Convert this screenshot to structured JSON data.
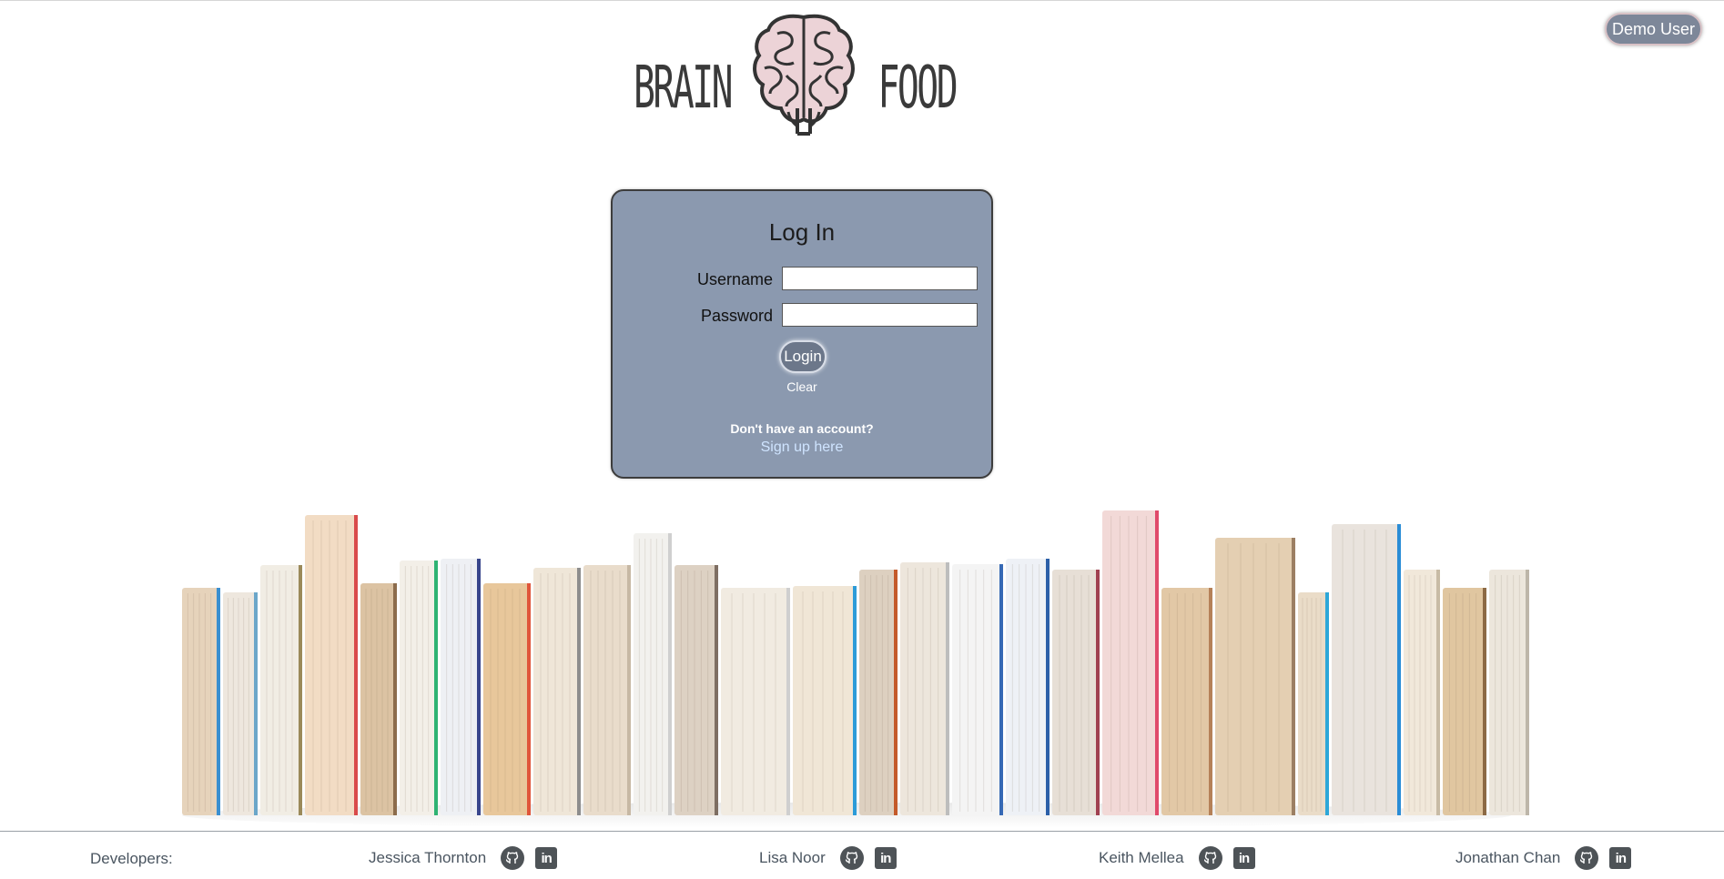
{
  "header": {
    "demo_button_label": "Demo User",
    "logo_left": "BRAIN",
    "logo_right": "FOOD"
  },
  "login": {
    "title": "Log In",
    "username_label": "Username",
    "username_value": "",
    "password_label": "Password",
    "password_value": "",
    "login_button": "Login",
    "clear_link": "Clear",
    "no_account_text": "Don't have an account?",
    "signup_link": "Sign up here"
  },
  "colors": {
    "card_background": "#8b99af",
    "button_background": "#6c778a",
    "signup_link": "#cfe4ff"
  },
  "footer": {
    "label": "Developers:",
    "developers": [
      {
        "name": "Jessica Thornton",
        "github_icon": "github-icon",
        "linkedin_icon": "linkedin-icon"
      },
      {
        "name": "Lisa Noor",
        "github_icon": "github-icon",
        "linkedin_icon": "linkedin-icon"
      },
      {
        "name": "Keith Mellea",
        "github_icon": "github-icon",
        "linkedin_icon": "linkedin-icon"
      },
      {
        "name": "Jonathan Chan",
        "github_icon": "github-icon",
        "linkedin_icon": "linkedin-icon"
      }
    ]
  }
}
